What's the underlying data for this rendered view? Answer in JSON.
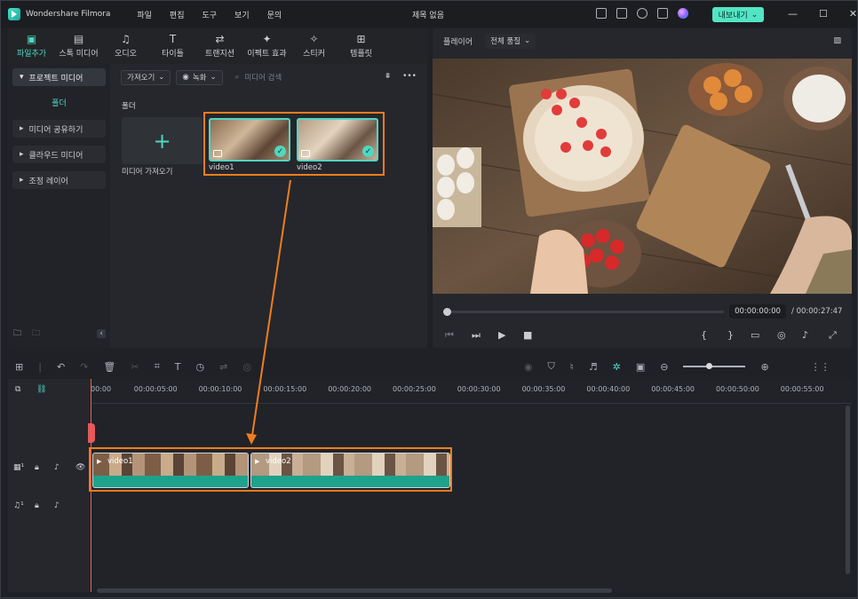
{
  "app": {
    "name": "Wondershare Filmora",
    "doc_title": "제목 없음",
    "export_label": "내보내기"
  },
  "menu": [
    "파일",
    "편집",
    "도구",
    "보기",
    "문의"
  ],
  "tabs": [
    {
      "label": "파일추가",
      "icon": "media-icon"
    },
    {
      "label": "스톡 미디어",
      "icon": "stock-icon"
    },
    {
      "label": "오디오",
      "icon": "music-icon"
    },
    {
      "label": "타이틀",
      "icon": "title-icon"
    },
    {
      "label": "트랜지션",
      "icon": "transition-icon"
    },
    {
      "label": "이펙트 효과",
      "icon": "effects-icon"
    },
    {
      "label": "스티커",
      "icon": "sticker-icon"
    },
    {
      "label": "템플릿",
      "icon": "template-icon"
    }
  ],
  "sidebar": {
    "project_media": "프로젝트 미디어",
    "folder": "폴더",
    "items": [
      "미디어 공유하기",
      "클라우드 미디어",
      "조정 레이어"
    ]
  },
  "media": {
    "import_dropdown": "가져오기",
    "record_dropdown": "녹화",
    "search_placeholder": "미디어 검색",
    "folder_label": "폴더",
    "import_media": "미디어 가져오기",
    "clips": [
      "video1",
      "video2"
    ]
  },
  "player": {
    "label": "플레이어",
    "quality": "전체 품질",
    "current_time": "00:00:00:00",
    "total_time": "00:00:27:47"
  },
  "timeline": {
    "ticks": [
      "00:00",
      "00:00:05:00",
      "00:00:10:00",
      "00:00:15:00",
      "00:00:20:00",
      "00:00:25:00",
      "00:00:30:00",
      "00:00:35:00",
      "00:00:40:00",
      "00:00:45:00",
      "00:00:50:00",
      "00:00:55:00"
    ],
    "clips": [
      {
        "name": "video1"
      },
      {
        "name": "video2"
      }
    ]
  },
  "colors": {
    "accent": "#4fd7c2",
    "highlight": "#f07d1e",
    "playhead": "#ef5b5b"
  }
}
